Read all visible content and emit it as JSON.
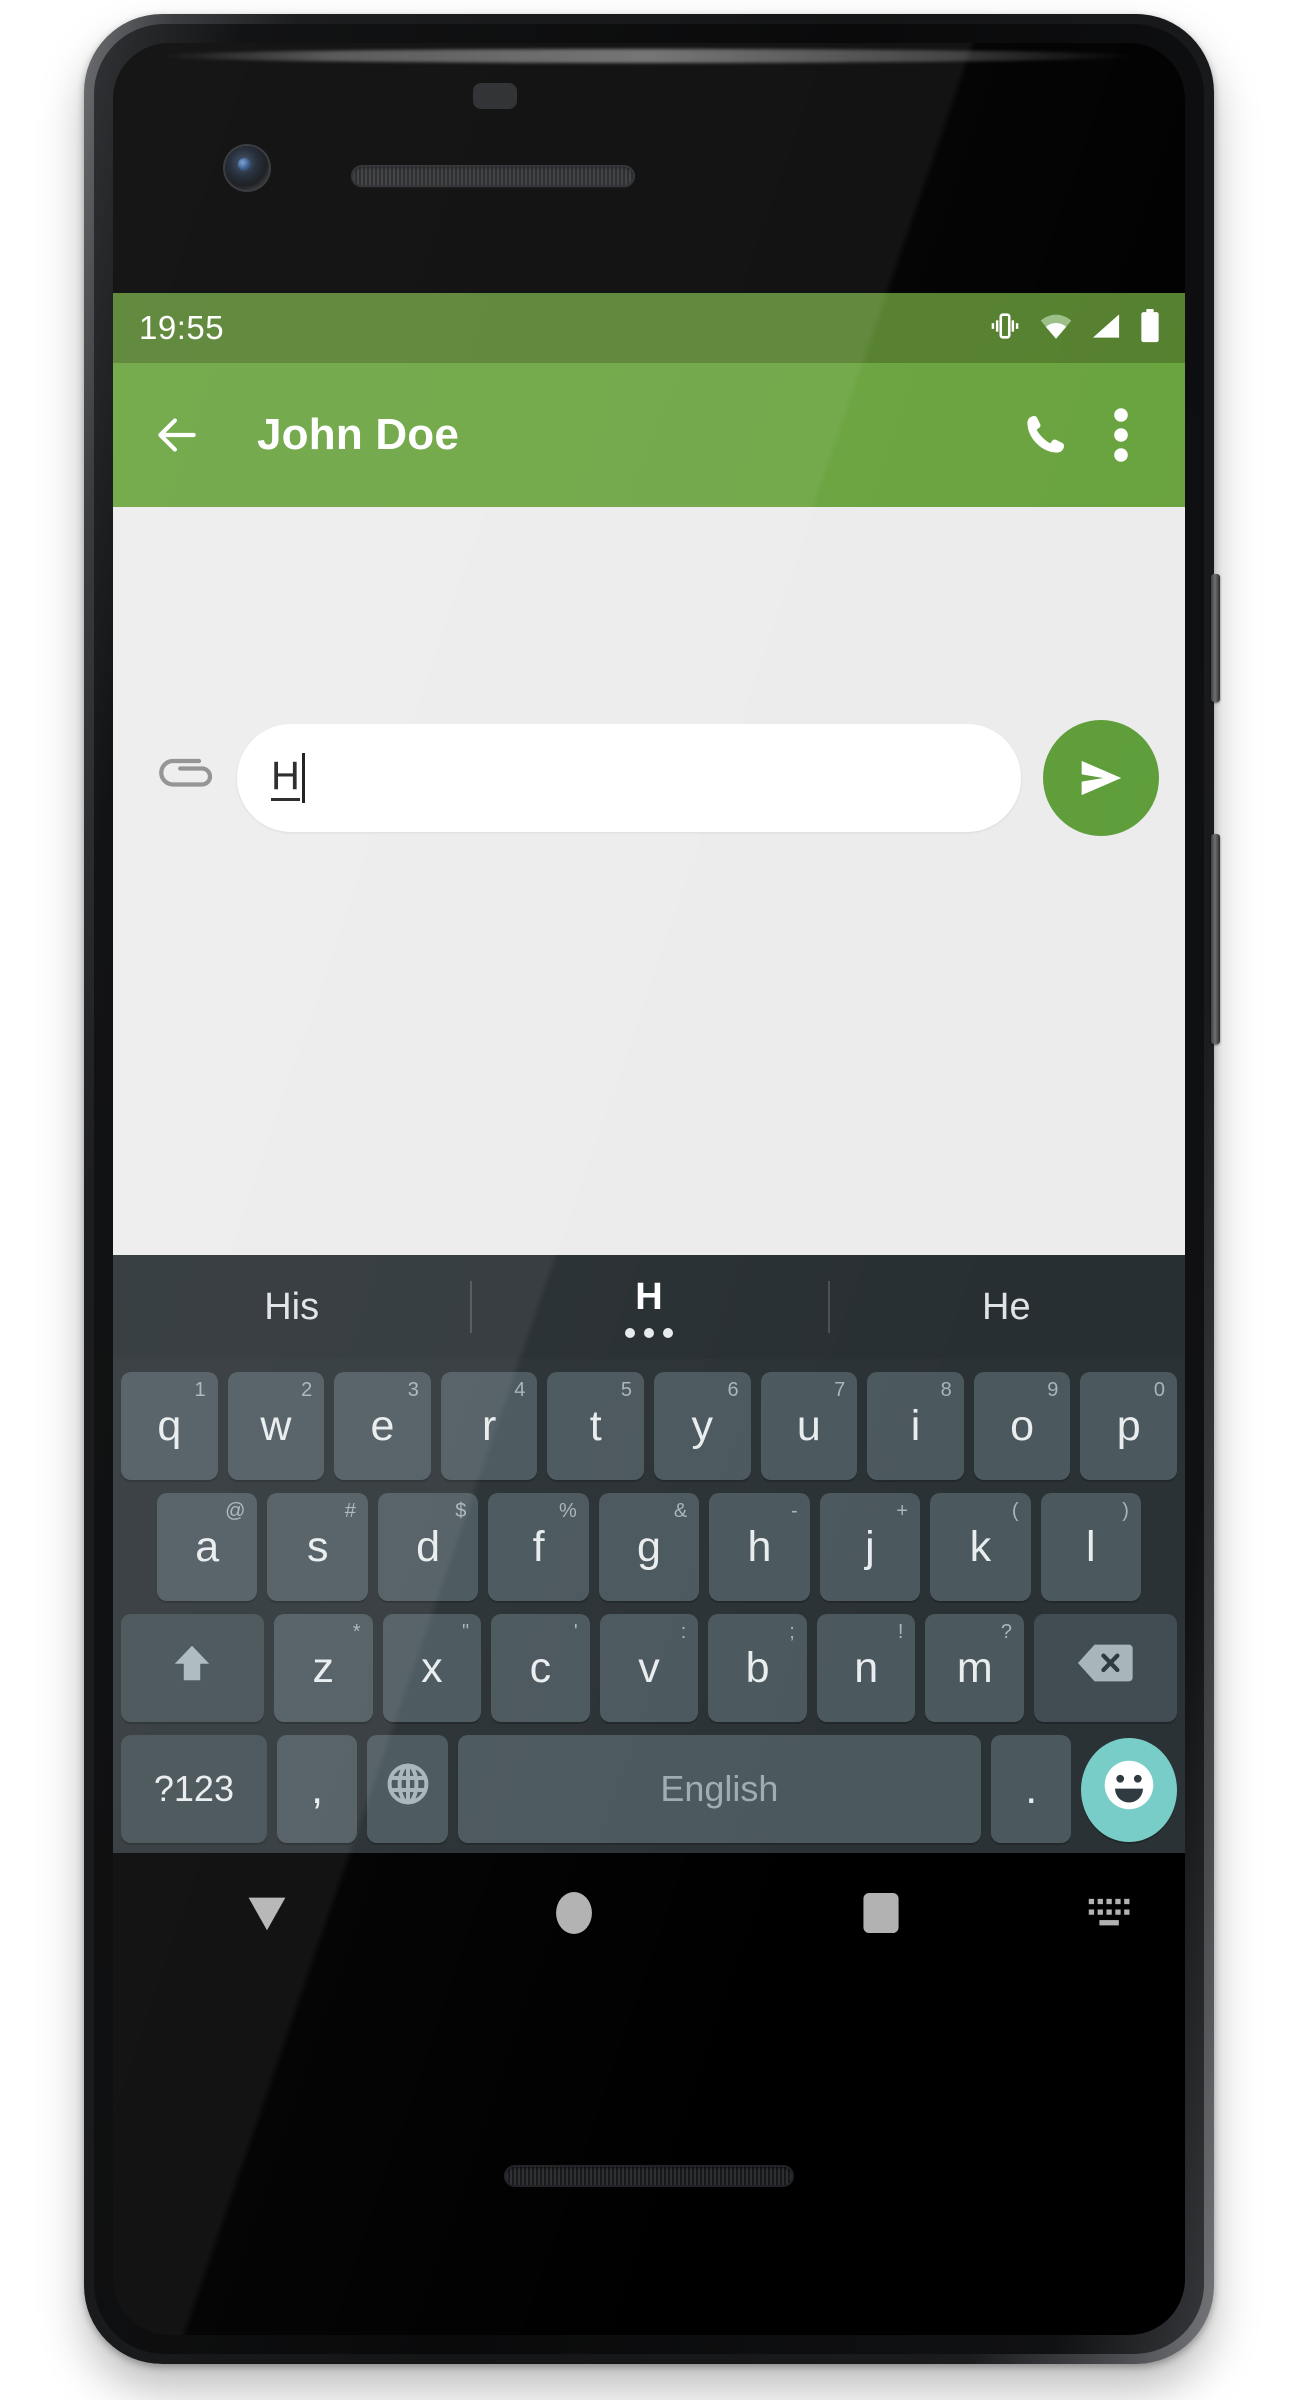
{
  "status_bar": {
    "clock": "19:55",
    "icons": [
      "vibrate-icon",
      "wifi-icon",
      "signal-icon",
      "battery-icon"
    ]
  },
  "app_bar": {
    "back_icon": "back-arrow-icon",
    "title": "John Doe",
    "call_icon": "phone-call-icon",
    "overflow_icon": "overflow-menu-icon",
    "bg_color": "#69a33e",
    "status_bg_color": "#55802e"
  },
  "compose": {
    "attach_icon": "paperclip-icon",
    "message_value": "H",
    "placeholder": "",
    "send_icon": "send-icon",
    "send_color": "#5f9e3b"
  },
  "keyboard": {
    "suggestions": [
      {
        "label": "His",
        "active": false
      },
      {
        "label": "H",
        "active": true
      },
      {
        "label": "He",
        "active": false
      }
    ],
    "rows": [
      [
        {
          "label": "q",
          "sup": "1"
        },
        {
          "label": "w",
          "sup": "2"
        },
        {
          "label": "e",
          "sup": "3"
        },
        {
          "label": "r",
          "sup": "4"
        },
        {
          "label": "t",
          "sup": "5"
        },
        {
          "label": "y",
          "sup": "6"
        },
        {
          "label": "u",
          "sup": "7"
        },
        {
          "label": "i",
          "sup": "8"
        },
        {
          "label": "o",
          "sup": "9"
        },
        {
          "label": "p",
          "sup": "0"
        }
      ],
      [
        {
          "label": "a",
          "sup": "@"
        },
        {
          "label": "s",
          "sup": "#"
        },
        {
          "label": "d",
          "sup": "$"
        },
        {
          "label": "f",
          "sup": "%"
        },
        {
          "label": "g",
          "sup": "&"
        },
        {
          "label": "h",
          "sup": "-"
        },
        {
          "label": "j",
          "sup": "+"
        },
        {
          "label": "k",
          "sup": "("
        },
        {
          "label": "l",
          "sup": ")"
        }
      ],
      [
        {
          "label": "",
          "sup": "",
          "icon": "shift-icon"
        },
        {
          "label": "z",
          "sup": "*"
        },
        {
          "label": "x",
          "sup": "\""
        },
        {
          "label": "c",
          "sup": "'"
        },
        {
          "label": "v",
          "sup": ":"
        },
        {
          "label": "b",
          "sup": ";"
        },
        {
          "label": "n",
          "sup": "!"
        },
        {
          "label": "m",
          "sup": "?"
        },
        {
          "label": "",
          "sup": "",
          "icon": "backspace-icon"
        }
      ]
    ],
    "bottom_row": {
      "symbols_label": "?123",
      "comma_label": ",",
      "language_icon": "globe-icon",
      "space_label": "English",
      "period_label": ".",
      "emoji_icon": "emoji-smiley-icon",
      "emoji_color": "#79cdc8"
    }
  },
  "nav_bar": {
    "back_icon": "keyboard-down-icon",
    "home_icon": "home-circle-icon",
    "recents_icon": "recents-square-icon",
    "switcher_icon": "keyboard-switcher-icon"
  }
}
